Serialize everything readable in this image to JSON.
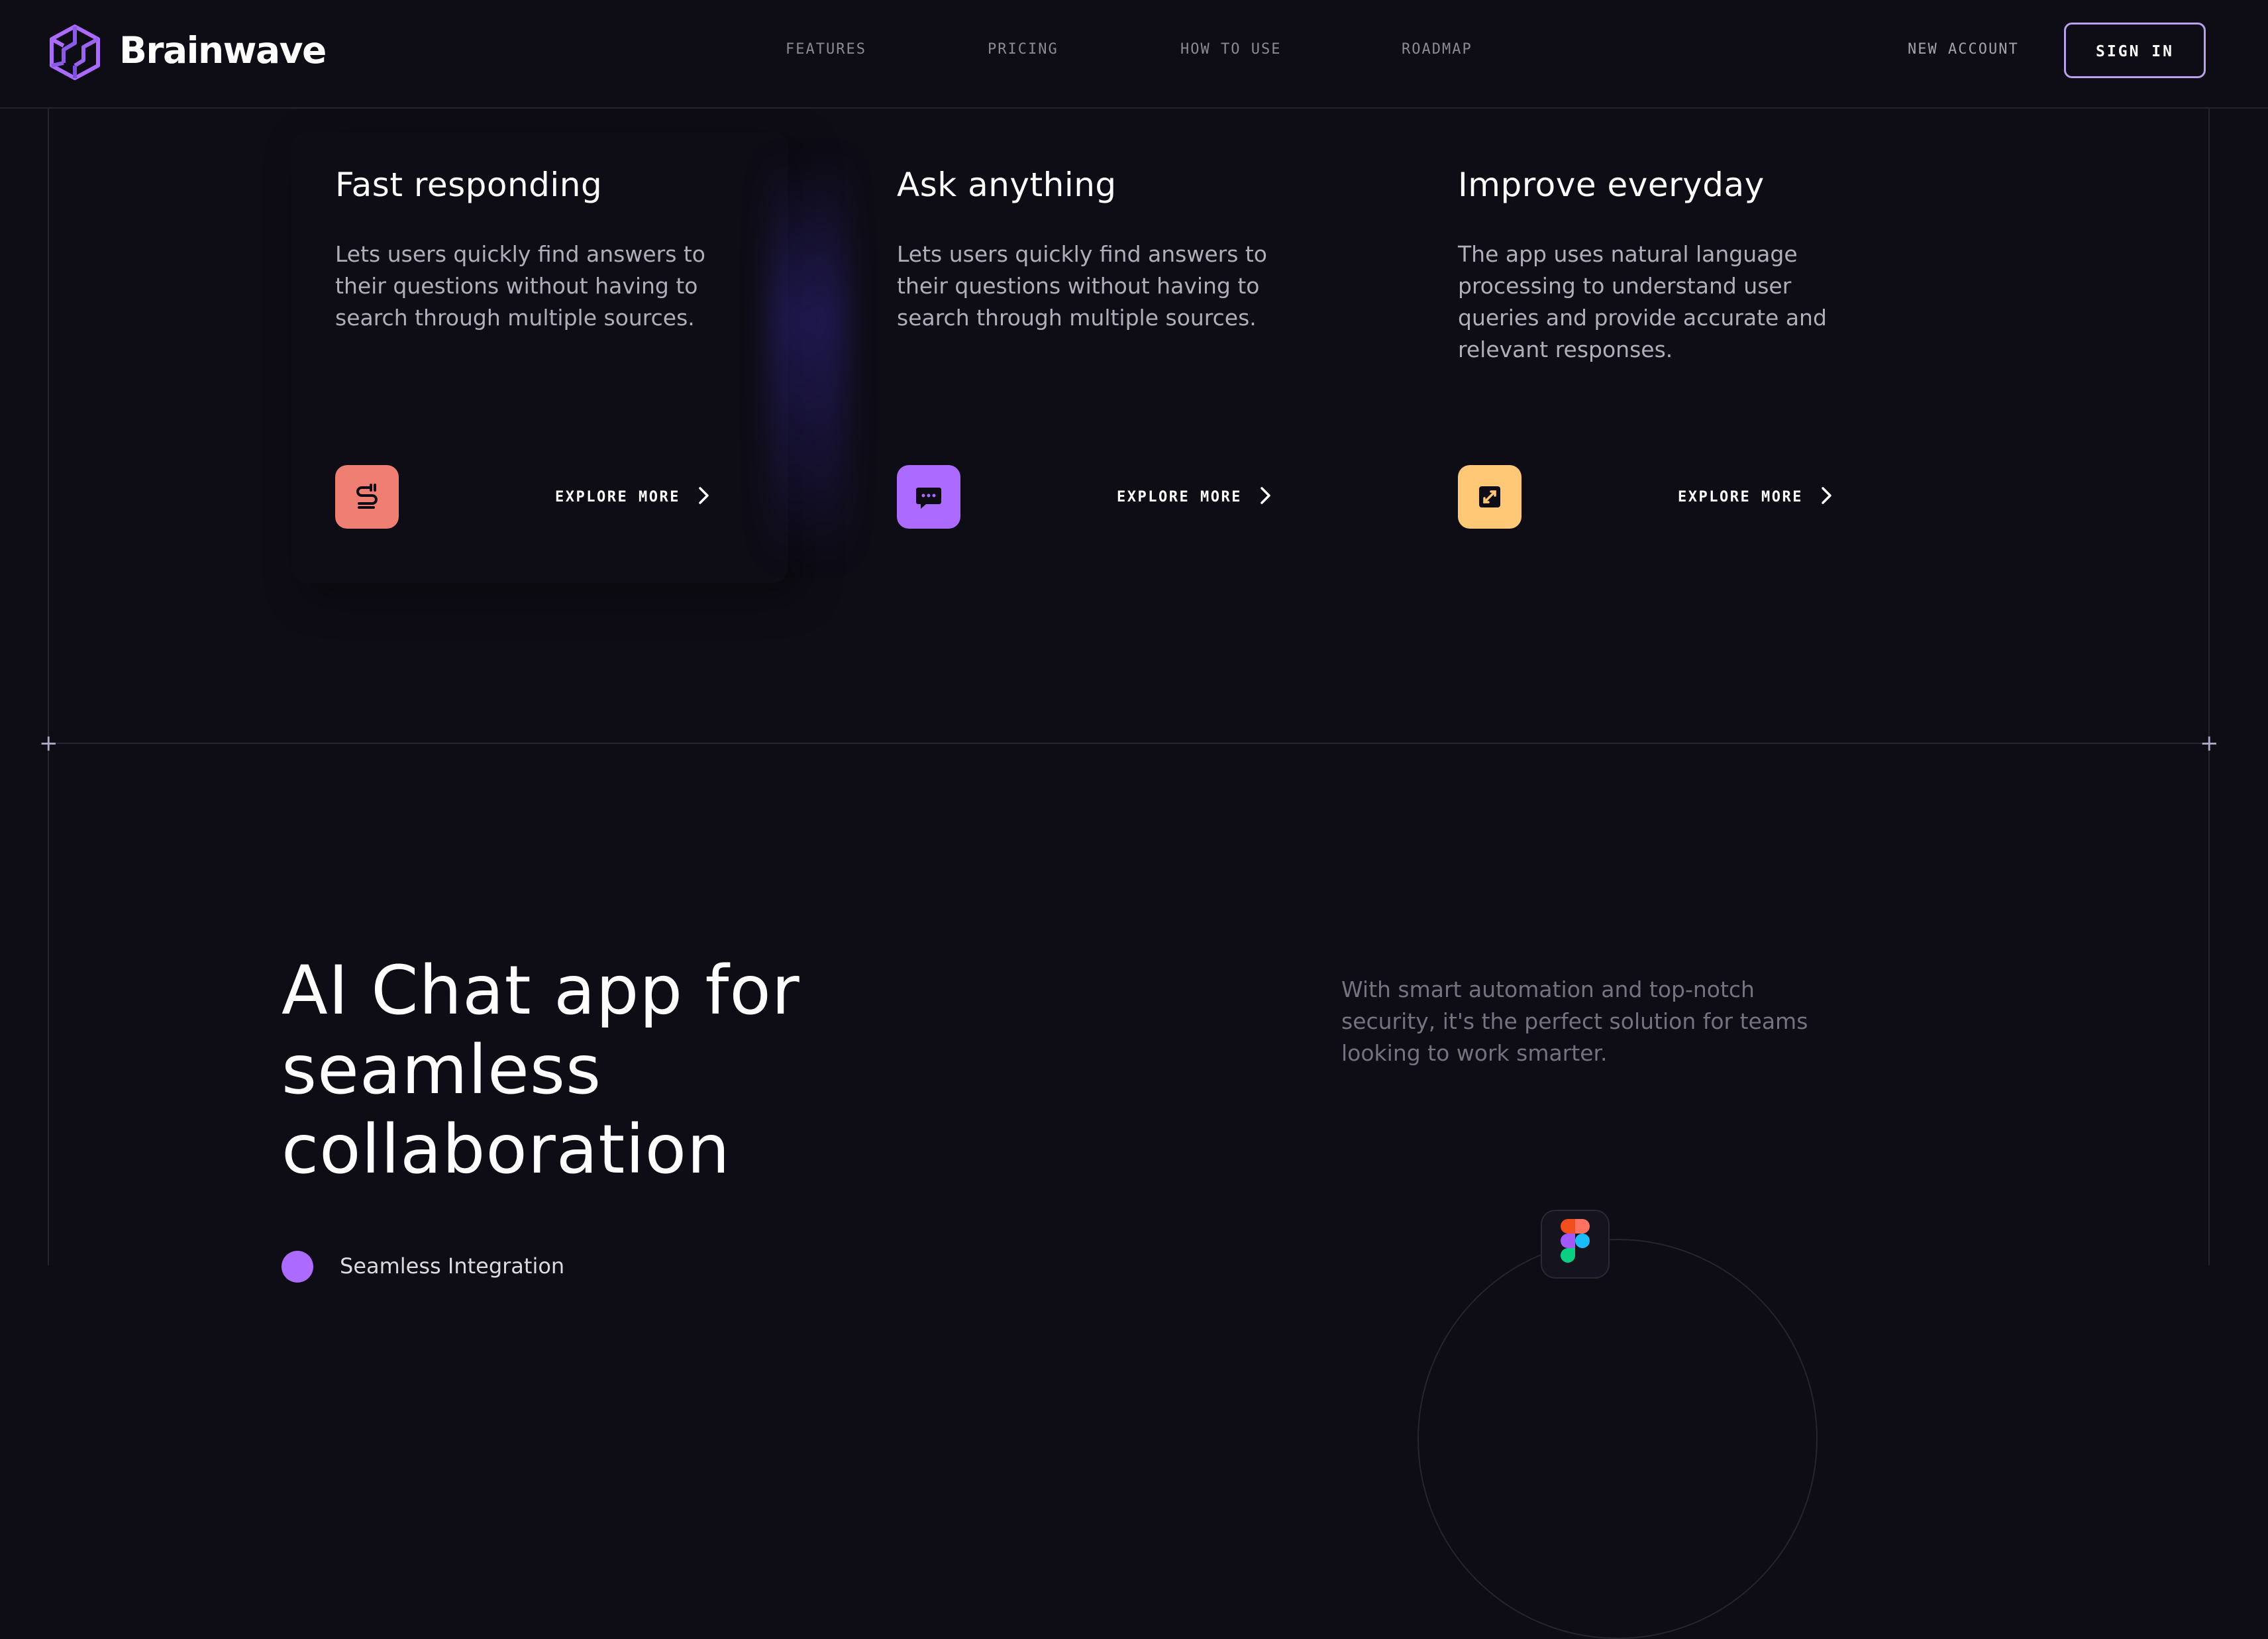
{
  "header": {
    "brand": "Brainwave",
    "nav": [
      "FEATURES",
      "PRICING",
      "HOW TO USE",
      "ROADMAP"
    ],
    "new_account": "NEW ACCOUNT",
    "sign_in": "SIGN IN"
  },
  "features": [
    {
      "title": "Fast responding",
      "text": "Lets users quickly find answers to their questions without having to search through multiple sources.",
      "cta": "EXPLORE MORE",
      "icon": "plug-icon",
      "icon_color": "#ef7e73"
    },
    {
      "title": "Ask anything",
      "text": "Lets users quickly find answers to their questions without having to search through multiple sources.",
      "cta": "EXPLORE MORE",
      "icon": "chat-bubble-icon",
      "icon_color": "#ac6aff"
    },
    {
      "title": "Improve everyday",
      "text": "The app uses natural language processing to understand user queries and provide accurate and relevant responses.",
      "cta": "EXPLORE MORE",
      "icon": "expand-icon",
      "icon_color": "#ffc876"
    }
  ],
  "collab": {
    "title": "AI Chat app for seamless collaboration",
    "description": "With smart automation and top-notch security, it's the perfect solution for teams looking to work smarter.",
    "list": [
      "Seamless Integration"
    ],
    "app_icon": "figma-icon"
  },
  "colors": {
    "background": "#0e0c15",
    "accent": "#ac6aff",
    "stroke": "#26242c"
  }
}
